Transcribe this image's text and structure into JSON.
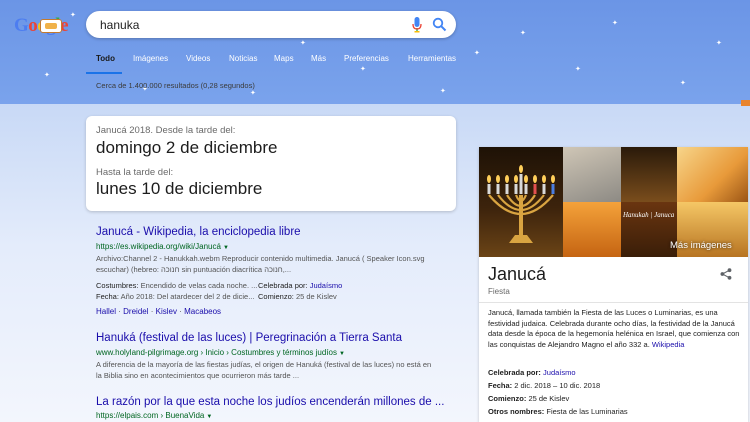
{
  "search": {
    "query": "hanuka"
  },
  "tabs": [
    "Todo",
    "Imágenes",
    "Videos",
    "Noticias",
    "Maps",
    "Más",
    "Preferencias",
    "Herramientas"
  ],
  "results_count": "Cerca de 1.400.000 resultados (0,28 segundos)",
  "date_card": {
    "line1_label": "Janucá 2018. Desde la tarde del:",
    "line1_value": "domingo 2 de diciembre",
    "line2_label": "Hasta la tarde del:",
    "line2_value": "lunes 10 de diciembre"
  },
  "results": [
    {
      "title": "Janucá - Wikipedia, la enciclopedia libre",
      "url": "https://es.wikipedia.org/wiki/Janucá",
      "snippet1": "Archivo:Channel 2 - Hanukkah.webm Reproducir contenido multimedia. Janucá ( Speaker Icon.svg",
      "snippet2": "escuchar) (hebreo: חנוכה sin puntuación diacrítica חנוכה,...",
      "facts": {
        "costumbres_label": "Costumbres:",
        "costumbres_value": "Encendido de velas cada noche. ...",
        "celebrada_label": "Celebrada por:",
        "celebrada_value": "Judaísmo",
        "fecha_label": "Fecha:",
        "fecha_value": "Año 2018: Del atardecer del 2 de dicie...",
        "comienzo_label": "Comienzo:",
        "comienzo_value": "25 de Kislev"
      },
      "sitelinks": [
        "Hallel",
        "Dreidel",
        "Kislev",
        "Macabeos"
      ]
    },
    {
      "title": "Hanuká (festival de las luces) | Peregrinación a Tierra Santa",
      "url": "www.holyland-pilgrimage.org › Inicio › Costumbres y términos judíos",
      "snippet1": "A diferencia de la mayoría de las fiestas judías, el origen de Hanuká (festival de las luces) no está en",
      "snippet2": "la Biblia sino en acontecimientos que ocurrieron más tarde ..."
    },
    {
      "title": "La razón por la que esta noche los judíos encenderán millones de ...",
      "url": "https://elpais.com › BuenaVida"
    }
  ],
  "knowledge_panel": {
    "title": "Janucá",
    "subtitle": "Fiesta",
    "more_images": "Más imágenes",
    "image_caption": "Hanukah | Januca",
    "description_pre": "Janucá, llamada también la Fiesta de las Luces o Luminarias, es una festividad judaica. Celebrada durante ocho días, la festividad de la Janucá data desde la época de la hegemonía helénica en Israel, que comienza con las conquistas de Alejandro Magno el año 332 a.",
    "description_link": "Wikipedia",
    "facts": [
      {
        "label": "Celebrada por:",
        "value": "Judaísmo",
        "link": true
      },
      {
        "label": "Fecha:",
        "value": "2 dic. 2018 – 10 dic. 2018",
        "link": false
      },
      {
        "label": "Comienzo:",
        "value": "25 de Kislev",
        "link": false
      },
      {
        "label": "Otros nombres:",
        "value": "Fiesta de las Luminarias",
        "link": false
      }
    ]
  },
  "colors": {
    "header": "#6b95e6",
    "link": "#1a0dab",
    "url": "#006621",
    "accent": "#1a73e8"
  }
}
